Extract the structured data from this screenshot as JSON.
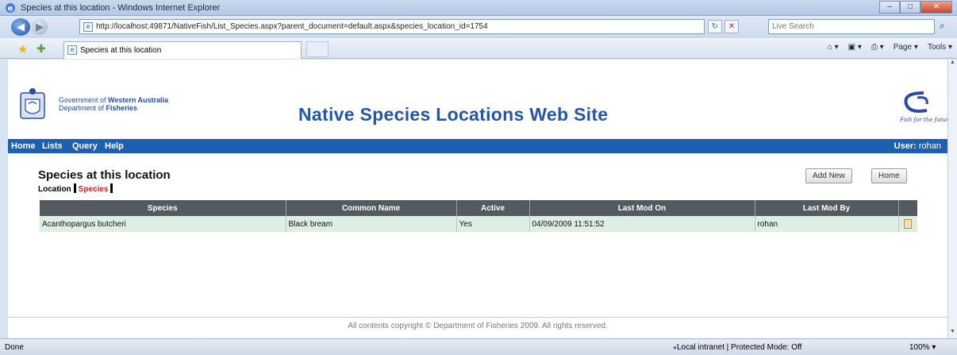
{
  "window": {
    "title": "Species at this location - Windows Internet Explorer"
  },
  "address": {
    "url": "http://localhost:49871/NativeFish/List_Species.aspx?parent_document=default.aspx&species_location_id=1754",
    "search_placeholder": "Live Search"
  },
  "tab": {
    "label": "Species at this location"
  },
  "commands": {
    "page": "Page ▾",
    "tools": "Tools ▾"
  },
  "header": {
    "gov_line1_prefix": "Government of ",
    "gov_line1_bold": "Western Australia",
    "gov_line2_prefix": "Department of ",
    "gov_line2_bold": "Fisheries",
    "site_title": "Native Species Locations Web Site",
    "logo_tagline": "Fish for the future"
  },
  "menu": {
    "items": [
      "Home",
      "Lists",
      "Query",
      "Help"
    ],
    "user_label": "User:",
    "user_name": "rohan"
  },
  "content": {
    "page_title": "Species at this location",
    "subtabs": [
      "Location",
      "Species"
    ],
    "add_new": "Add New",
    "home": "Home"
  },
  "table": {
    "columns": [
      "Species",
      "Common Name",
      "Active",
      "Last Mod On",
      "Last Mod By",
      ""
    ],
    "rows": [
      {
        "species": "Acanthopargus butcheri",
        "common_name": "Black bream",
        "active": "Yes",
        "last_mod_on": "04/09/2009 11:51:52",
        "last_mod_by": "rohan"
      }
    ]
  },
  "footer": {
    "copyright": "All contents copyright © Department of Fisheries 2009. All rights reserved."
  },
  "status": {
    "done": "Done",
    "zone": "Local intranet | Protected Mode: Off",
    "zoom": "100% ▾"
  },
  "colors": {
    "menu_bar": "#1f5fb0",
    "site_title": "#2456a6",
    "table_header": "#555a60",
    "table_row": "#dfeee5",
    "active_subtab": "#cc2020"
  }
}
